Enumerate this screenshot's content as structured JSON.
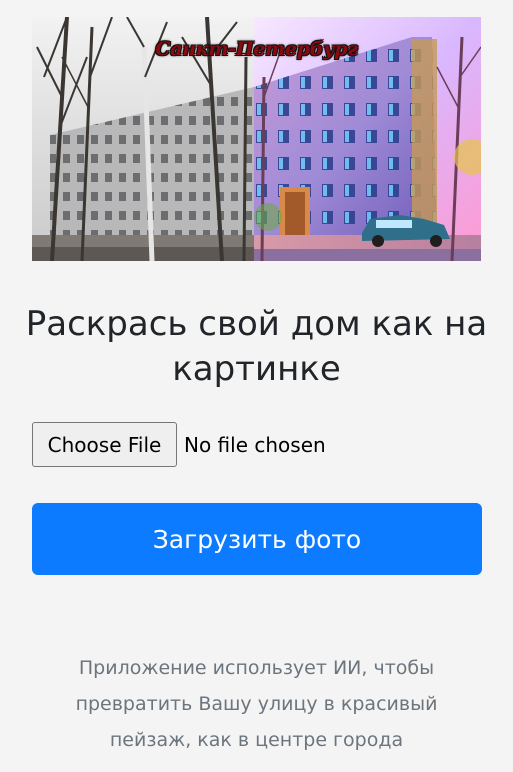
{
  "hero": {
    "overlay_text": "Санкт-Петербург"
  },
  "heading": "Раскрась свой дом как на картинке",
  "file_input": {
    "button_label": "Choose File",
    "status": "No file chosen"
  },
  "upload_button_label": "Загрузить фото",
  "description": "Приложение использует ИИ, чтобы превратить Вашу улицу в красивый пейзаж, как в центре города",
  "colors": {
    "primary": "#0d7bff",
    "background": "#f4f4f4",
    "muted_text": "#6c757d",
    "title_text": "#212529"
  }
}
